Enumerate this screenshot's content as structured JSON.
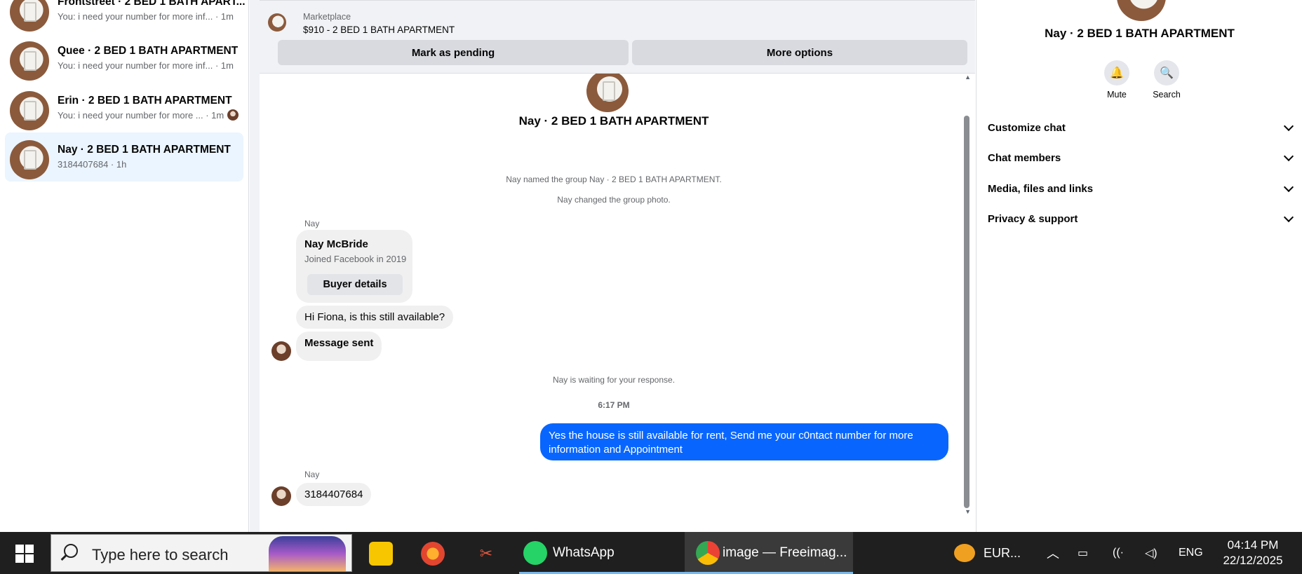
{
  "conversations": [
    {
      "name": "Frontstreet · 2 BED 1 BATH APART...",
      "preview": "You: i need your number for more inf... · 1m"
    },
    {
      "name": "Quee · 2 BED 1 BATH APARTMENT",
      "preview": "You: i need your number for more inf... · 1m"
    },
    {
      "name": "Erin · 2 BED 1 BATH APARTMENT",
      "preview": "You: i need your number for more ... · 1m"
    },
    {
      "name": "Nay · 2 BED 1 BATH APARTMENT",
      "preview": "3184407684 · 1h"
    }
  ],
  "marketplace": {
    "label": "Marketplace",
    "listing": "$910 - 2 BED 1 BATH APARTMENT",
    "mark_pending": "Mark as pending",
    "more_options": "More options"
  },
  "chat": {
    "title": "Nay · 2 BED 1 BATH APARTMENT",
    "sys_named": "Nay named the group Nay · 2 BED 1 BATH APARTMENT.",
    "sys_photo": "Nay changed the group photo.",
    "sender1": "Nay",
    "card_name": "Nay McBride",
    "card_joined": "Joined Facebook in 2019",
    "card_button": "Buyer details",
    "msg1": "Hi Fiona, is this still available?",
    "msg2": "Message sent",
    "sys_waiting": "Nay is waiting for your response.",
    "time": "6:17 PM",
    "my_msg": "Yes the house is still available for rent, Send me your c0ntact number for more information and Appointment",
    "sender2": "Nay",
    "msg3": "3184407684"
  },
  "panel": {
    "title": "Nay · 2 BED 1 BATH APARTMENT",
    "mute": "Mute",
    "search": "Search",
    "sections": [
      "Customize chat",
      "Chat members",
      "Media, files and links",
      "Privacy & support"
    ]
  },
  "taskbar": {
    "search_placeholder": "Type here to search",
    "whatsapp": "WhatsApp",
    "browser": "image — Freeimag...",
    "currency": "EUR...",
    "lang": "ENG",
    "time": "04:14 PM",
    "date": "22/12/2025"
  },
  "colors": {
    "accent": "#0866ff",
    "active_row": "#ebf5ff",
    "taskbar": "#1f1f1f"
  }
}
